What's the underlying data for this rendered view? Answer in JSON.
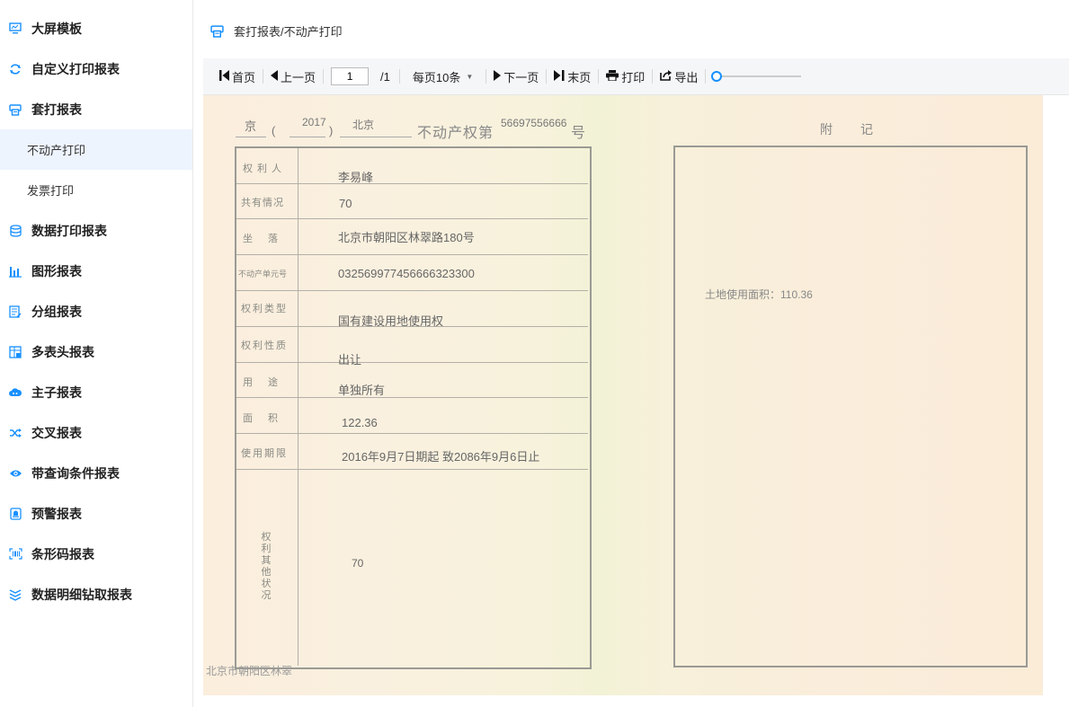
{
  "sidebar": {
    "items": [
      {
        "label": "大屏模板",
        "icon": "monitor-icon"
      },
      {
        "label": "自定义打印报表",
        "icon": "refresh-icon"
      },
      {
        "label": "套打报表",
        "icon": "printer-icon"
      },
      {
        "label": "不动产打印"
      },
      {
        "label": "发票打印"
      },
      {
        "label": "数据打印报表",
        "icon": "database-icon"
      },
      {
        "label": "图形报表",
        "icon": "bar-chart-icon"
      },
      {
        "label": "分组报表",
        "icon": "list-edit-icon"
      },
      {
        "label": "多表头报表",
        "icon": "table-header-icon"
      },
      {
        "label": "主子报表",
        "icon": "cloud-icon"
      },
      {
        "label": "交叉报表",
        "icon": "shuffle-icon"
      },
      {
        "label": "带查询条件报表",
        "icon": "eye-icon"
      },
      {
        "label": "预警报表",
        "icon": "alert-icon"
      },
      {
        "label": "条形码报表",
        "icon": "barcode-icon"
      },
      {
        "label": "数据明细钻取报表",
        "icon": "layers-icon"
      }
    ],
    "active_index": 3
  },
  "breadcrumb": {
    "text": "套打报表/不动产打印"
  },
  "toolbar": {
    "first": "首页",
    "prev": "上一页",
    "page_value": "1",
    "page_total": "/1",
    "page_size": "每页10条",
    "next": "下一页",
    "last": "末页",
    "print": "打印",
    "export": "导出",
    "zoom_level": 0
  },
  "document": {
    "header": {
      "jing": "京",
      "paren_open": "(",
      "year": "2017",
      "paren_close": ")",
      "city": "北京",
      "cert_title": "不动产权第",
      "cert_no": "56697556666",
      "hao": "号",
      "fuji": "附　　记"
    },
    "rows": [
      {
        "label": "权利人",
        "value": "李易峰"
      },
      {
        "label": "共有情况",
        "value": "70"
      },
      {
        "label": "坐　落",
        "value": "北京市朝阳区林翠路180号"
      },
      {
        "label": "不动产单元号",
        "value": "032569977456666323300"
      },
      {
        "label": "权利类型",
        "value": "国有建设用地使用权"
      },
      {
        "label": "权利性质",
        "value": "出让"
      },
      {
        "label": "用　途",
        "value": "单独所有"
      },
      {
        "label": "面　积",
        "value": "122.36"
      },
      {
        "label": "使用期限",
        "value": "2016年9月7日期起 致2086年9月6日止"
      }
    ],
    "other": {
      "label": "权利其他状况",
      "value": "70"
    },
    "fuji_text": "土地使用面积：110.36",
    "footer_text": "北京市朝阳区林翠"
  }
}
